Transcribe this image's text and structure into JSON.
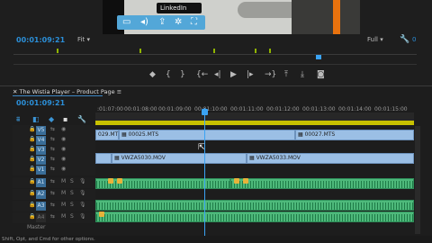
{
  "program_monitor": {
    "timecode": "00:01:09:21",
    "zoom": "Fit",
    "quality": "Full",
    "video_tooltip": "LinkedIn",
    "ports": [
      {
        "icon": "marker-icon",
        "glyph": "◆"
      },
      {
        "icon": "mark-in-icon",
        "glyph": "{"
      },
      {
        "icon": "mark-out-icon",
        "glyph": "}"
      },
      {
        "icon": "goto-in-icon",
        "glyph": "{←"
      },
      {
        "icon": "step-back-icon",
        "glyph": "◂|"
      },
      {
        "icon": "play-icon",
        "glyph": "▶"
      },
      {
        "icon": "step-forward-icon",
        "glyph": "|▸"
      },
      {
        "icon": "goto-out-icon",
        "glyph": "→}"
      },
      {
        "icon": "lift-icon",
        "glyph": "⤒"
      },
      {
        "icon": "extract-icon",
        "glyph": "⤓"
      },
      {
        "icon": "export-frame-icon",
        "glyph": "◙"
      }
    ]
  },
  "timeline": {
    "sequence_name": "The Wistia Player – Product Page",
    "timecode": "00:01:09:21",
    "ruler_labels": [
      ":01:07:00",
      "00:01:08:00",
      "00:01:09:00",
      "00:01:10:00",
      "00:01:11:00",
      "00:01:12:00",
      "00:01:13:00",
      "00:01:14:00",
      "00:01:15:00"
    ],
    "tracks": [
      {
        "name": "V5",
        "active": true
      },
      {
        "name": "V4",
        "active": true
      },
      {
        "name": "V3",
        "active": true
      },
      {
        "name": "V2",
        "active": true
      },
      {
        "name": "V1",
        "active": true
      },
      {
        "name": "A1",
        "active": true
      },
      {
        "name": "A2",
        "active": true
      },
      {
        "name": "A3",
        "active": true
      },
      {
        "name": "A4",
        "active": false
      }
    ],
    "audio_flags": {
      "m": "M",
      "s": "S"
    },
    "clips": {
      "v4_a": "029.MTS",
      "v4_b": "00025.MTS",
      "v4_c": "00027.MTS",
      "v2_a": "VWZA5030.MOV",
      "v2_b": "VWZA5033.MOV"
    },
    "master_label": "Master"
  },
  "status_bar": "Shift, Opt, and Cmd for other options."
}
